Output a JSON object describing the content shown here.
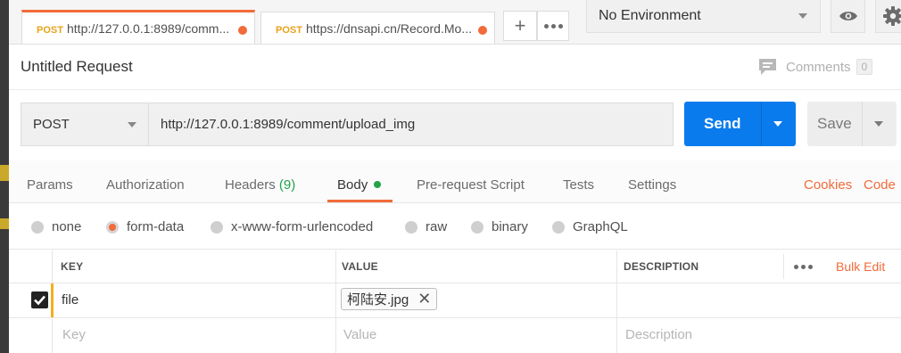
{
  "tabs": [
    {
      "method": "POST",
      "url": "http://127.0.0.1:8989/comm..."
    },
    {
      "method": "POST",
      "url": "https://dnsapi.cn/Record.Mo..."
    }
  ],
  "tab_actions": {
    "new_tab": "+",
    "more": "•••"
  },
  "environment": {
    "selected": "No Environment"
  },
  "request": {
    "title": "Untitled Request",
    "comments_label": "Comments",
    "comments_count": "0",
    "method": "POST",
    "url": "http://127.0.0.1:8989/comment/upload_img",
    "send_label": "Send",
    "save_label": "Save"
  },
  "request_tabs": [
    {
      "label": "Params"
    },
    {
      "label": "Authorization"
    },
    {
      "label": "Headers",
      "count": "(9)"
    },
    {
      "label": "Body"
    },
    {
      "label": "Pre-request Script"
    },
    {
      "label": "Tests"
    },
    {
      "label": "Settings"
    }
  ],
  "links": {
    "cookies": "Cookies",
    "code": "Code"
  },
  "body_types": [
    "none",
    "form-data",
    "x-www-form-urlencoded",
    "raw",
    "binary",
    "GraphQL"
  ],
  "body_type_selected": "form-data",
  "table": {
    "headers": {
      "key": "KEY",
      "value": "VALUE",
      "description": "DESCRIPTION"
    },
    "bulk_edit": "Bulk Edit",
    "rows": [
      {
        "key": "file",
        "value": "柯陆安.jpg",
        "description": "",
        "checked": true
      }
    ],
    "placeholders": {
      "key": "Key",
      "value": "Value",
      "description": "Description"
    }
  },
  "colors": {
    "accent": "#f26b3a",
    "send": "#097bed",
    "active_dot": "#22a34a"
  }
}
